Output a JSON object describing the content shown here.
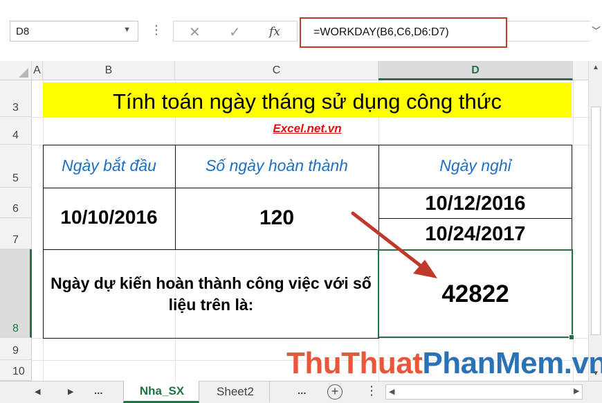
{
  "formula_bar": {
    "name_box": "D8",
    "cancel_symbol": "✕",
    "enter_symbol": "✓",
    "fx_symbol": "fx",
    "formula": "=WORKDAY(B6,C6,D6:D7)",
    "highlight_color": "#c0392b"
  },
  "columns": [
    "A",
    "B",
    "C",
    "D"
  ],
  "rows": [
    "3",
    "4",
    "5",
    "6",
    "7",
    "8",
    "9",
    "10"
  ],
  "sheet": {
    "title": "Tính toán ngày tháng sử dụng công thức",
    "title_fill": "#ffff00",
    "site": "Excel.net.vn",
    "headers": {
      "start_date": "Ngày bắt đầu",
      "days_to_complete": "Số ngày hoàn thành",
      "holidays": "Ngày nghỉ"
    },
    "values": {
      "start_date": "10/10/2016",
      "days_to_complete": "120",
      "holiday_1": "10/12/2016",
      "holiday_2": "10/24/2017"
    },
    "result_label": "Ngày dự kiến hoàn thành công việc với số liệu trên là:",
    "result_value": "42822",
    "accent_color": "#217346",
    "header_text_color": "#1c6fc2"
  },
  "watermark": {
    "part1": "ThuThuat",
    "part2": "PhanMem.vn"
  },
  "tabs": {
    "prev_symbol": "◀",
    "next_symbol": "▶",
    "more_left": "...",
    "active": "Nha_SX",
    "other": "Sheet2",
    "more_right": "...",
    "add_symbol": "+"
  }
}
